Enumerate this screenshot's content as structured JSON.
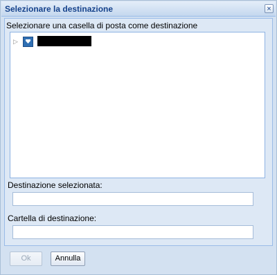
{
  "dialog": {
    "title": "Selezionare la destinazione",
    "close_glyph": "×"
  },
  "tree": {
    "prompt": "Selezionare una casella di posta come destinazione",
    "items": [
      {
        "expander": "▷",
        "icon": "mailbox-icon",
        "label_redacted": true
      }
    ]
  },
  "destination": {
    "label": "Destinazione selezionata:",
    "value": ""
  },
  "folder": {
    "label": "Cartella di destinazione:",
    "value": ""
  },
  "buttons": {
    "ok_label": "Ok",
    "ok_enabled": false,
    "cancel_label": "Annulla"
  }
}
